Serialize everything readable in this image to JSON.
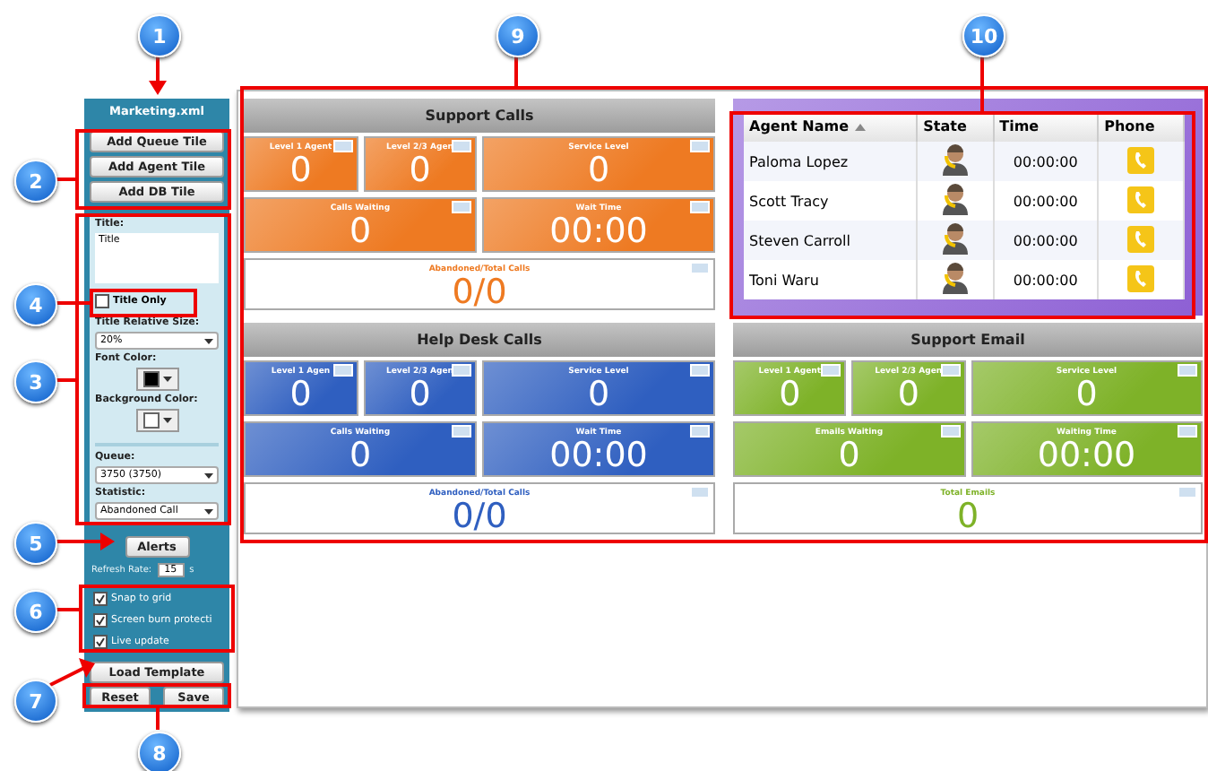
{
  "sidebar": {
    "file_name": "Marketing.xml",
    "add_buttons": [
      "Add Queue Tile",
      "Add Agent Tile",
      "Add DB Tile"
    ],
    "title_label": "Title:",
    "title_value": "Title",
    "title_only": {
      "label": "Title Only",
      "checked": false
    },
    "size_label": "Title Relative Size:",
    "size_value": "20%",
    "font_color_label": "Font Color:",
    "background_color_label": "Background Color:",
    "queue_label": "Queue:",
    "queue_value": "3750 (3750)",
    "statistic_label": "Statistic:",
    "statistic_value": "Abandoned Call",
    "alerts_button": "Alerts",
    "refresh_label": "Refresh Rate:",
    "refresh_value": "15",
    "refresh_unit": "s",
    "options": [
      {
        "label": "Snap to grid",
        "checked": true
      },
      {
        "label": "Screen burn protecti",
        "checked": true
      },
      {
        "label": "Live update",
        "checked": true
      }
    ],
    "load_button": "Load Template",
    "reset_button": "Reset",
    "save_button": "Save"
  },
  "groups": [
    {
      "kind": "queue",
      "color": "#ee7a22",
      "title": "Support Calls",
      "tiles": [
        {
          "label": "Level 1 Agent",
          "value": "0"
        },
        {
          "label": "Level 2/3 Agen",
          "value": "0"
        },
        {
          "label": "Service Level",
          "value": "0"
        },
        {
          "label": "Calls Waiting",
          "value": "0"
        },
        {
          "label": "Wait Time",
          "value": "00:00"
        }
      ],
      "total": {
        "label": "Abandoned/Total Calls",
        "value": "0/0"
      }
    },
    {
      "kind": "agents",
      "columns": [
        {
          "label": "Agent Name",
          "sorted": true
        },
        {
          "label": "State",
          "sorted": false
        },
        {
          "label": "Time",
          "sorted": false
        },
        {
          "label": "Phone",
          "sorted": false
        }
      ],
      "rows": [
        {
          "name": "Paloma Lopez",
          "time": "00:00:00"
        },
        {
          "name": "Scott Tracy",
          "time": "00:00:00"
        },
        {
          "name": "Steven Carroll",
          "time": "00:00:00"
        },
        {
          "name": "Toni Waru",
          "time": "00:00:00"
        }
      ]
    },
    {
      "kind": "queue",
      "color": "#2f5fc0",
      "title": "Help Desk Calls",
      "tiles": [
        {
          "label": "Level 1 Agen",
          "value": "0"
        },
        {
          "label": "Level 2/3 Agen",
          "value": "0"
        },
        {
          "label": "Service Level",
          "value": "0"
        },
        {
          "label": "Calls Waiting",
          "value": "0"
        },
        {
          "label": "Wait Time",
          "value": "00:00"
        }
      ],
      "total": {
        "label": "Abandoned/Total Calls",
        "value": "0/0"
      }
    },
    {
      "kind": "queue",
      "color": "#7eb228",
      "title": "Support Email",
      "tiles": [
        {
          "label": "Level 1 Agent",
          "value": "0"
        },
        {
          "label": "Level 2/3 Agen",
          "value": "0"
        },
        {
          "label": "Service Level",
          "value": "0"
        },
        {
          "label": "Emails Waiting",
          "value": "0"
        },
        {
          "label": "Waiting Time",
          "value": "00:00"
        }
      ],
      "total": {
        "label": "Total Emails",
        "value": "0"
      }
    }
  ],
  "callouts": [
    "1",
    "9",
    "10",
    "2",
    "4",
    "3",
    "5",
    "6",
    "7",
    "8"
  ]
}
